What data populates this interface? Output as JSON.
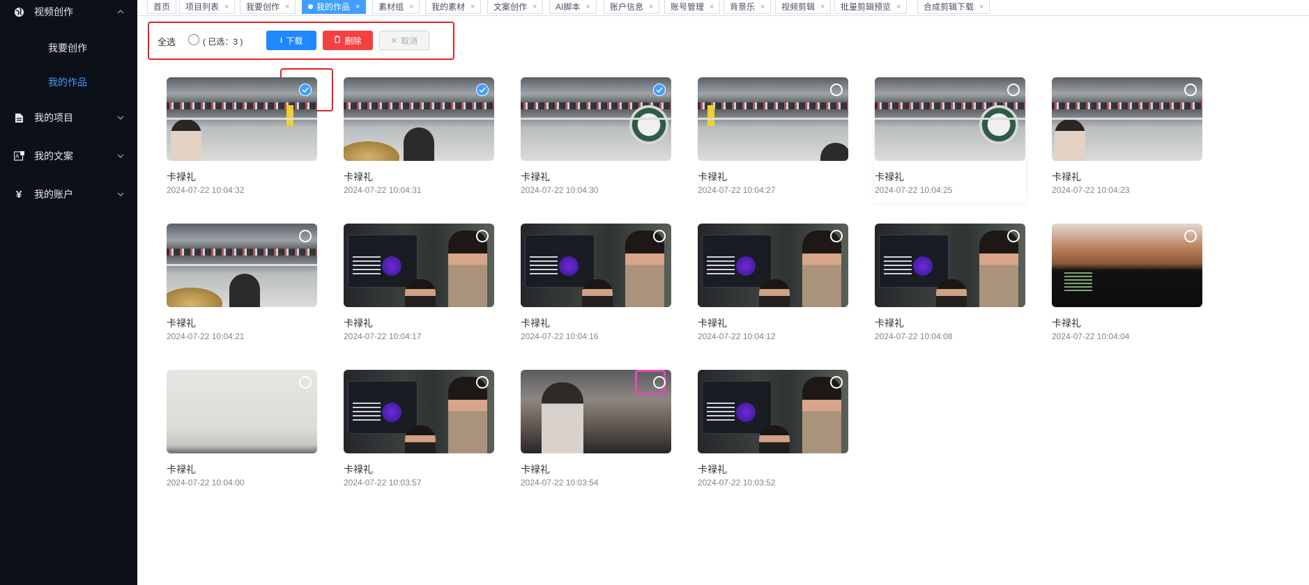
{
  "sidebar": {
    "top_item": {
      "label": "视频创作",
      "icon": "globe-icon",
      "arrow": "chevron-up-icon"
    },
    "sub_items": [
      {
        "label": "我要创作",
        "active": false
      },
      {
        "label": "我的作品",
        "active": true
      }
    ],
    "items": [
      {
        "label": "我的项目",
        "icon": "document-icon",
        "arrow": "chevron-down-icon"
      },
      {
        "label": "我的文案",
        "icon": "text-icon",
        "arrow": "chevron-down-icon"
      },
      {
        "label": "我的账户",
        "icon": "yen-icon",
        "arrow": "chevron-down-icon"
      }
    ]
  },
  "tabs": [
    {
      "label": "首页",
      "closable": false,
      "active": false
    },
    {
      "label": "项目列表",
      "closable": true,
      "active": false
    },
    {
      "label": "我要创作",
      "closable": true,
      "active": false
    },
    {
      "label": "我的作品",
      "closable": true,
      "active": true
    },
    {
      "label": "素材组",
      "closable": true,
      "active": false
    },
    {
      "label": "我的素材",
      "closable": true,
      "active": false
    },
    {
      "label": "文案创作",
      "closable": true,
      "active": false
    },
    {
      "label": "AI脚本",
      "closable": true,
      "active": false
    },
    {
      "label": "账户信息",
      "closable": true,
      "active": false
    },
    {
      "label": "账号管理",
      "closable": true,
      "active": false
    },
    {
      "label": "背景乐",
      "closable": true,
      "active": false
    },
    {
      "label": "视频剪辑",
      "closable": true,
      "active": false
    },
    {
      "label": "批量剪辑预览",
      "closable": true,
      "active": false
    },
    {
      "label": "合成剪辑下载",
      "closable": true,
      "active": false
    }
  ],
  "toolbar": {
    "select_all_label": "全选",
    "selected_text": "( 已选：3 )",
    "download_label": "下载",
    "delete_label": "删除",
    "cancel_label": "取消"
  },
  "works": [
    {
      "title": "卡禄礼",
      "time": "2024-07-22 10:04:32",
      "checked": true
    },
    {
      "title": "卡禄礼",
      "time": "2024-07-22 10:04:31",
      "checked": true
    },
    {
      "title": "卡禄礼",
      "time": "2024-07-22 10:04:30",
      "checked": true
    },
    {
      "title": "卡禄礼",
      "time": "2024-07-22 10:04:27",
      "checked": false
    },
    {
      "title": "卡禄礼",
      "time": "2024-07-22 10:04:25",
      "checked": false
    },
    {
      "title": "卡禄礼",
      "time": "2024-07-22 10:04:23",
      "checked": false
    },
    {
      "title": "卡禄礼",
      "time": "2024-07-22 10:04:21",
      "checked": false
    },
    {
      "title": "卡禄礼",
      "time": "2024-07-22 10:04:17",
      "checked": false
    },
    {
      "title": "卡禄礼",
      "time": "2024-07-22 10:04:16",
      "checked": false
    },
    {
      "title": "卡禄礼",
      "time": "2024-07-22 10:04:12",
      "checked": false
    },
    {
      "title": "卡禄礼",
      "time": "2024-07-22 10:04:08",
      "checked": false
    },
    {
      "title": "卡禄礼",
      "time": "2024-07-22 10:04:04",
      "checked": false
    },
    {
      "title": "卡禄礼",
      "time": "2024-07-22 10:04:00",
      "checked": false
    },
    {
      "title": "卡禄礼",
      "time": "2024-07-22 10:03:57",
      "checked": false
    },
    {
      "title": "卡禄礼",
      "time": "2024-07-22 10:03:54",
      "checked": false
    },
    {
      "title": "卡禄礼",
      "time": "2024-07-22 10:03:52",
      "checked": false
    }
  ],
  "colors": {
    "sidebar_bg": "#0c1018",
    "accent": "#409eff",
    "danger": "#f34141",
    "highlight": "#e02020"
  }
}
